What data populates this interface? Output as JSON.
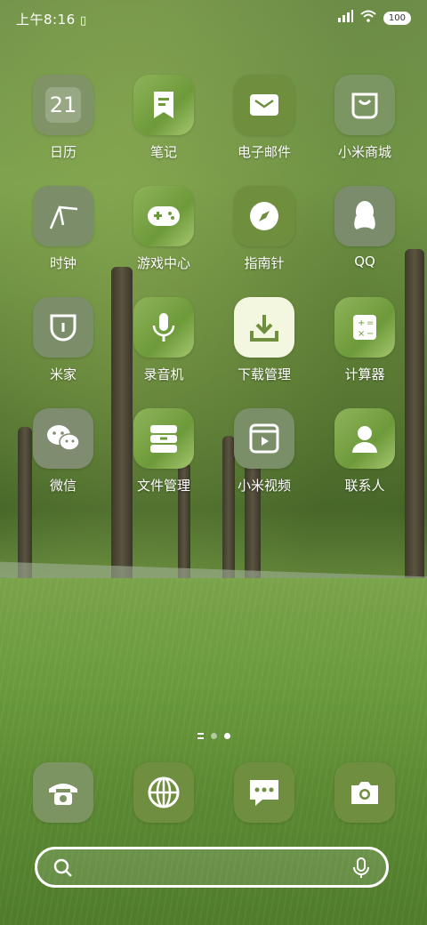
{
  "status": {
    "time": "上午8:16",
    "battery": "100"
  },
  "apps": [
    {
      "label": "日历",
      "icon": "calendar-icon",
      "date": "21"
    },
    {
      "label": "笔记",
      "icon": "notes-icon"
    },
    {
      "label": "电子邮件",
      "icon": "email-icon"
    },
    {
      "label": "小米商城",
      "icon": "shopping-bag-icon"
    },
    {
      "label": "时钟",
      "icon": "clock-icon"
    },
    {
      "label": "游戏中心",
      "icon": "gamepad-icon"
    },
    {
      "label": "指南针",
      "icon": "compass-icon"
    },
    {
      "label": "QQ",
      "icon": "penguin-icon"
    },
    {
      "label": "米家",
      "icon": "mijia-icon"
    },
    {
      "label": "录音机",
      "icon": "microphone-icon"
    },
    {
      "label": "下载管理",
      "icon": "download-icon"
    },
    {
      "label": "计算器",
      "icon": "calculator-icon"
    },
    {
      "label": "微信",
      "icon": "wechat-icon"
    },
    {
      "label": "文件管理",
      "icon": "file-manager-icon"
    },
    {
      "label": "小米视频",
      "icon": "video-icon"
    },
    {
      "label": "联系人",
      "icon": "contacts-icon"
    }
  ],
  "dock": [
    {
      "name": "phone",
      "icon": "phone-icon"
    },
    {
      "name": "browser",
      "icon": "globe-icon"
    },
    {
      "name": "messages",
      "icon": "message-icon"
    },
    {
      "name": "camera",
      "icon": "camera-icon"
    }
  ],
  "page_indicator": {
    "pages": 2,
    "current": 2
  }
}
